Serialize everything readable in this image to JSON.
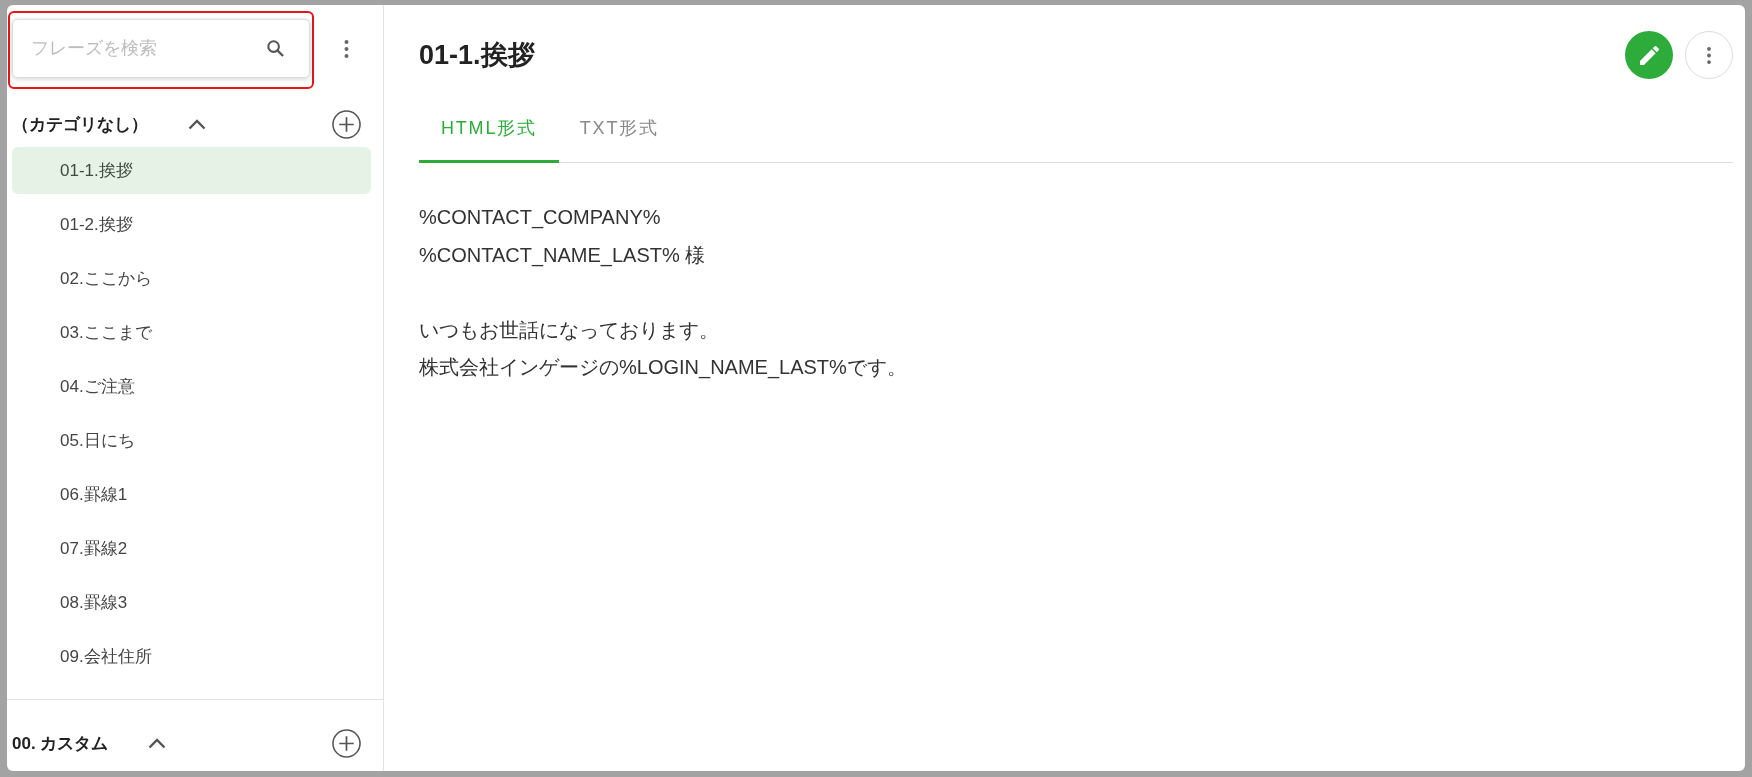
{
  "search": {
    "placeholder": "フレーズを検索",
    "highlighted": true
  },
  "categories": [
    {
      "name": "（カテゴリなし）",
      "expanded": true,
      "items": [
        {
          "label": "01-1.挨拶",
          "selected": true
        },
        {
          "label": "01-2.挨拶",
          "selected": false
        },
        {
          "label": "02.ここから",
          "selected": false
        },
        {
          "label": "03.ここまで",
          "selected": false
        },
        {
          "label": "04.ご注意",
          "selected": false
        },
        {
          "label": "05.日にち",
          "selected": false
        },
        {
          "label": "06.罫線1",
          "selected": false
        },
        {
          "label": "07.罫線2",
          "selected": false
        },
        {
          "label": "08.罫線3",
          "selected": false
        },
        {
          "label": "09.会社住所",
          "selected": false
        }
      ]
    },
    {
      "name": "00. カスタム",
      "expanded": true
    }
  ],
  "phrase": {
    "title": "01-1.挨拶"
  },
  "tabs": [
    {
      "label": "HTML形式",
      "selected": true
    },
    {
      "label": "TXT形式",
      "selected": false
    }
  ],
  "body": [
    [
      "%CONTACT_COMPANY%",
      "%CONTACT_NAME_LAST% 様"
    ],
    [
      "いつもお世話になっております。",
      "株式会社インゲージの%LOGIN_NAME_LAST%です。"
    ]
  ]
}
